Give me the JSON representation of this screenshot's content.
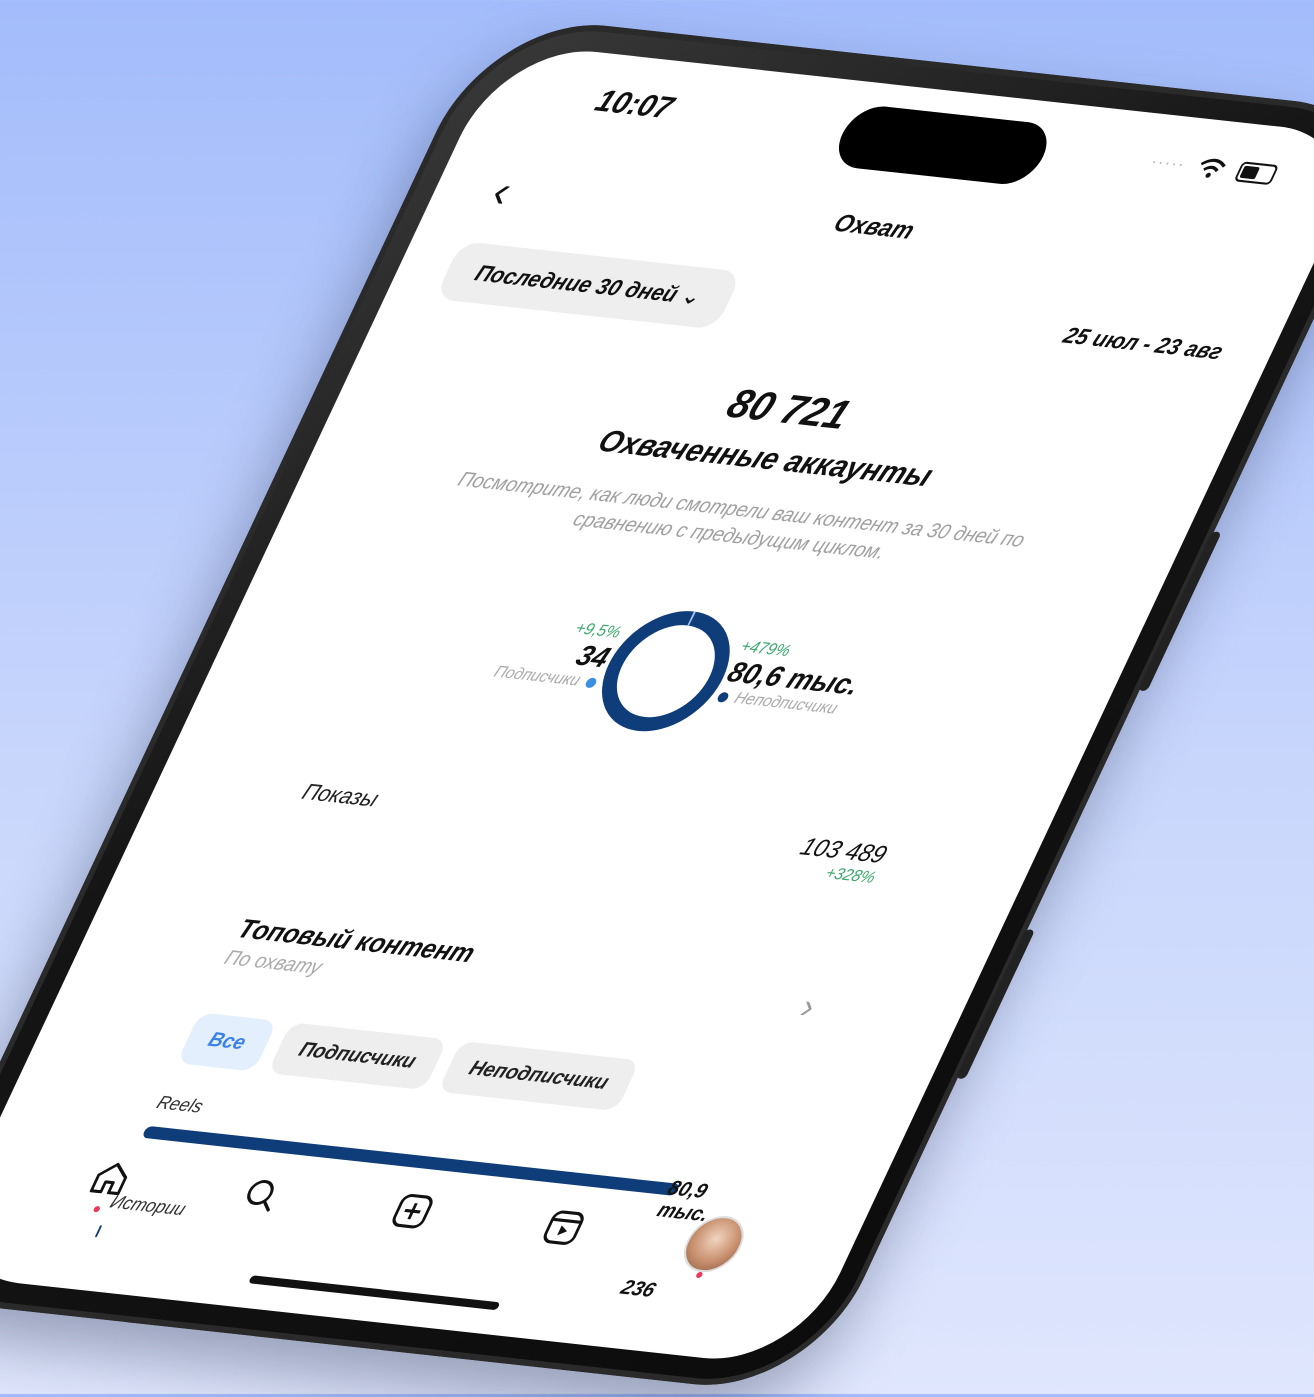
{
  "status": {
    "time": "10:07"
  },
  "header": {
    "title": "Охват",
    "back_icon": "chevron-left-icon"
  },
  "filter": {
    "period_label": "Последние 30 дней",
    "date_range": "25 июл - 23 авг"
  },
  "summary": {
    "total": "80 721",
    "label": "Охваченные аккаунты",
    "description": "Посмотрите, как люди смотрели ваш контент за 30 дней по сравнению с предыдущим циклом."
  },
  "breakdown": {
    "followers": {
      "change": "+9,5%",
      "value": "34",
      "label": "Подписчики",
      "color": "#3b8fe0"
    },
    "non_followers": {
      "change": "+479%",
      "value": "80,6 тыс.",
      "label": "Неподписчики",
      "color": "#0f3d79"
    },
    "followers_share": 0.0004
  },
  "impressions": {
    "label": "Показы",
    "value": "103 489",
    "change": "+328%"
  },
  "top_content": {
    "title": "Топовый контент",
    "subtitle": "По охвату"
  },
  "chips": [
    {
      "label": "Все",
      "active": true
    },
    {
      "label": "Подписчики",
      "active": false
    },
    {
      "label": "Неподписчики",
      "active": false
    }
  ],
  "content_types": [
    {
      "label": "Reels",
      "value": "80,9 тыс.",
      "fraction": 0.997
    },
    {
      "label": "Истории",
      "value": "236",
      "fraction": 0.003
    }
  ],
  "colors": {
    "accent": "#0f3d79",
    "positive": "#3aa86b",
    "chip_active": "#3b82e8"
  },
  "tabbar": [
    "home-icon",
    "search-icon",
    "create-icon",
    "reels-icon",
    "profile-avatar"
  ]
}
